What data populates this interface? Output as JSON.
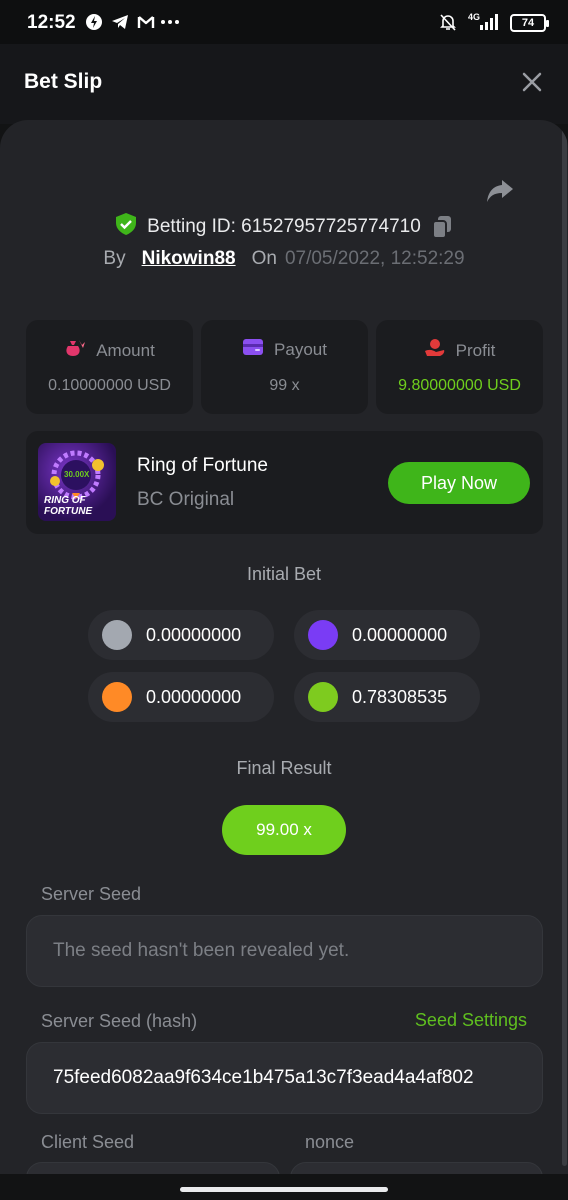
{
  "status_bar": {
    "time": "12:52",
    "network": "4G",
    "battery": "74",
    "icons": [
      "data-saver-icon",
      "telegram-icon",
      "gmail-icon",
      "more-dots-icon",
      "silent-bell-icon",
      "signal-icon",
      "battery-icon"
    ]
  },
  "header": {
    "title": "Bet Slip",
    "close_icon": "close-icon"
  },
  "bet": {
    "id_label": "Betting ID:",
    "id_value": "61527957725774710",
    "by_label": "By",
    "username": "Nikowin88",
    "on_label": "On",
    "date": "07/05/2022, 12:52:29"
  },
  "stats": {
    "amount_label": "Amount",
    "amount_value": "0.10000000 USD",
    "payout_label": "Payout",
    "payout_value": "99 x",
    "profit_label": "Profit",
    "profit_value": "9.80000000 USD"
  },
  "game": {
    "name": "Ring of Fortune",
    "subtitle": "BC Original",
    "play_label": "Play Now",
    "thumb_text_line1": "RING OF",
    "thumb_text_line2": "FORTUNE",
    "thumb_multiplier": "30.00X"
  },
  "initial_bet": {
    "title": "Initial Bet",
    "items": [
      {
        "color": "#a3a8b0",
        "value": "0.00000000"
      },
      {
        "color": "#7a3cf5",
        "value": "0.00000000"
      },
      {
        "color": "#ff8a26",
        "value": "0.00000000"
      },
      {
        "color": "#7ecb1f",
        "value": "0.78308535"
      }
    ]
  },
  "final_result": {
    "title": "Final Result",
    "value": "99.00 x"
  },
  "server_seed": {
    "label": "Server Seed",
    "value": "The seed hasn't been revealed yet."
  },
  "server_seed_hash": {
    "label": "Server Seed (hash)",
    "settings_label": "Seed Settings",
    "value": "75feed6082aa9f634ce1b475a13c7f3ead4a4af802"
  },
  "client_seed": {
    "label": "Client Seed"
  },
  "nonce": {
    "label": "nonce"
  },
  "colors": {
    "accent_green": "#6fcf1d",
    "play_button": "#3fb51a",
    "sheet_bg": "#232428"
  }
}
